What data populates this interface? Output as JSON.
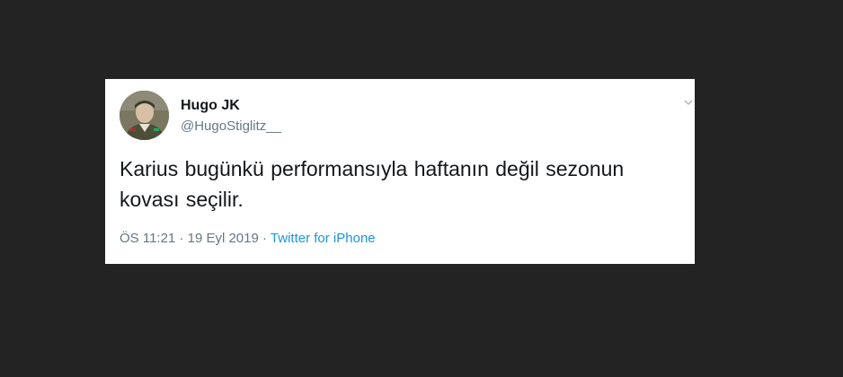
{
  "tweet": {
    "display_name": "Hugo JK",
    "handle": "@HugoStiglitz__",
    "text": "Karius bugünkü performansıyla haftanın değil sezonun kovası seçilir.",
    "time": "ÖS 11:21",
    "separator": " · ",
    "date": "19 Eyl 2019",
    "source": "Twitter for iPhone"
  },
  "icons": {
    "avatar": "avatar",
    "menu": "chevron-down-icon"
  },
  "colors": {
    "background": "#232323",
    "card": "#ffffff",
    "text": "#14171a",
    "muted": "#657786",
    "link": "#1b95e0"
  }
}
